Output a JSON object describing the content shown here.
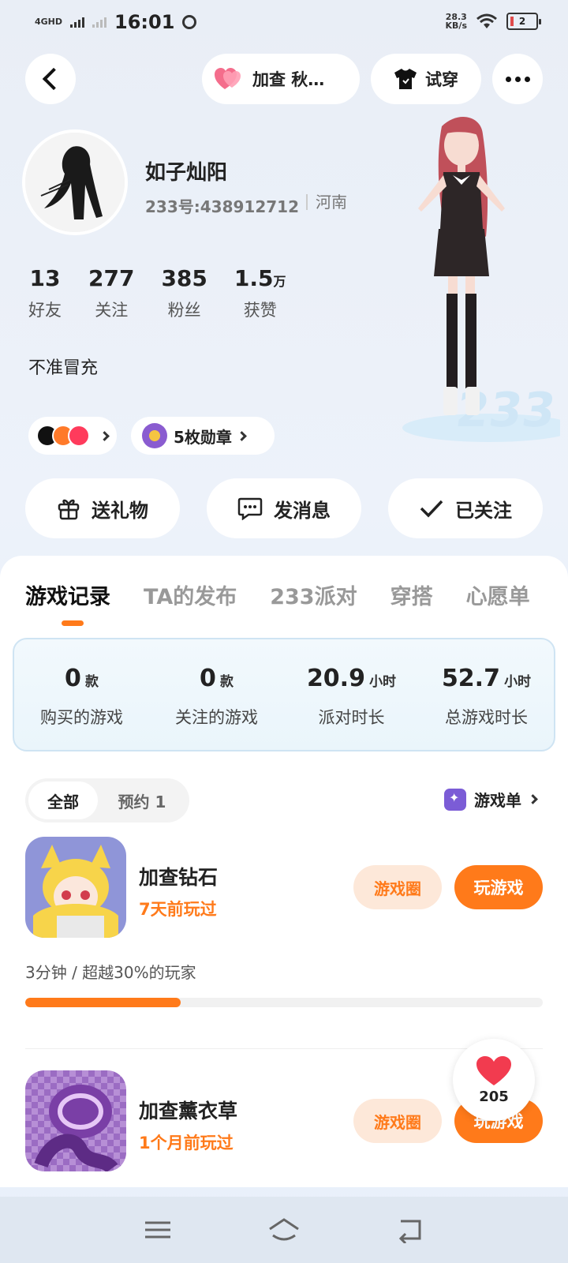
{
  "status_bar": {
    "network": "4GHD",
    "time": "16:01",
    "speed_value": "28.3",
    "speed_unit": "KB/s",
    "battery": "2"
  },
  "top_nav": {
    "game_label": "加查 秋…",
    "tryon_label": "试穿"
  },
  "profile": {
    "name": "如子灿阳",
    "id": "233号:438912712",
    "region": "河南",
    "bio": "不准冒充",
    "stats": [
      {
        "num": "13",
        "unit": "",
        "label": "好友"
      },
      {
        "num": "277",
        "unit": "",
        "label": "关注"
      },
      {
        "num": "385",
        "unit": "",
        "label": "粉丝"
      },
      {
        "num": "1.5",
        "unit": "万",
        "label": "获赞"
      }
    ],
    "badges_label": "5枚勋章"
  },
  "actions": {
    "gift": "送礼物",
    "message": "发消息",
    "followed": "已关注"
  },
  "tabs": [
    "游戏记录",
    "TA的发布",
    "233派对",
    "穿搭",
    "心愿单"
  ],
  "summary": [
    {
      "num": "0",
      "unit": "款",
      "label": "购买的游戏"
    },
    {
      "num": "0",
      "unit": "款",
      "label": "关注的游戏"
    },
    {
      "num": "20.9",
      "unit": "小时",
      "label": "派对时长"
    },
    {
      "num": "52.7",
      "unit": "小时",
      "label": "总游戏时长"
    }
  ],
  "filter": {
    "all": "全部",
    "reserve": "预约 1"
  },
  "game_list_label": "游戏单",
  "games": [
    {
      "name": "加查钻石",
      "last_played": "7天前玩过",
      "circle": "游戏圈",
      "play": "玩游戏",
      "playtime": "3分钟 / 超越30%的玩家",
      "progress": 0.3
    },
    {
      "name": "加查薰衣草",
      "last_played": "1个月前玩过",
      "circle": "游戏圈",
      "play": "玩游戏"
    }
  ],
  "like_count": "205",
  "colors": {
    "accent": "#ff7a1a",
    "accent_light": "#fde8d9"
  }
}
